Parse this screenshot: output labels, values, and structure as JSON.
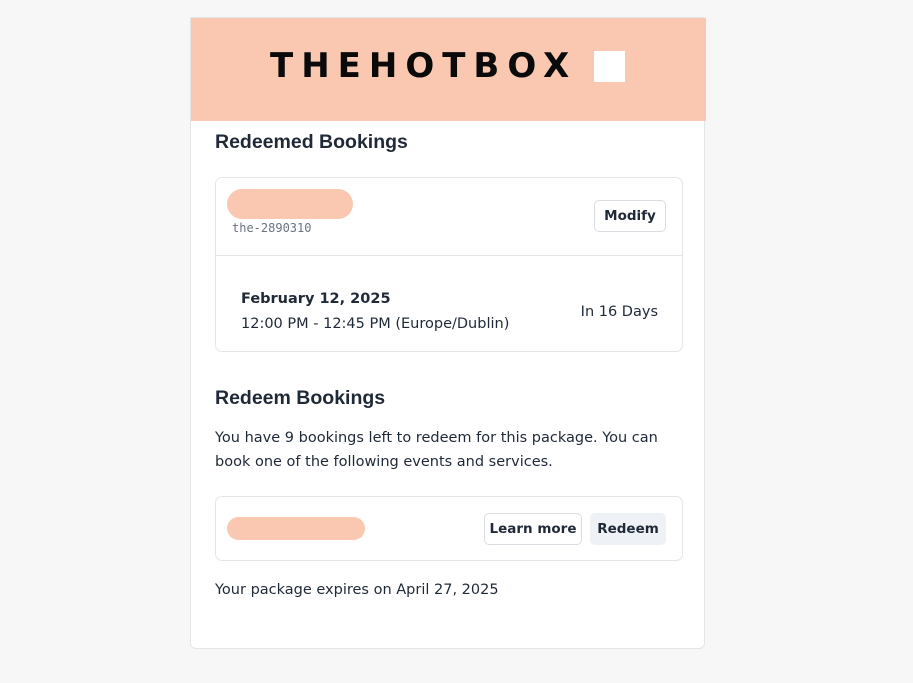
{
  "brand": {
    "logo_text": "THEHOTBOX",
    "banner_color": "#fac8b0"
  },
  "redeemed": {
    "title": "Redeemed Bookings",
    "booking": {
      "code": "the-2890310",
      "modify_label": "Modify",
      "date": "February 12, 2025",
      "time": "12:00 PM - 12:45 PM (Europe/Dublin)",
      "relative": "In 16 Days"
    }
  },
  "redeem": {
    "title": "Redeem Bookings",
    "description": "You have 9 bookings left to redeem for this package. You can book one of the following events and services.",
    "item": {
      "learn_more_label": "Learn more",
      "redeem_label": "Redeem"
    },
    "expires_text": "Your package expires on April 27, 2025"
  }
}
